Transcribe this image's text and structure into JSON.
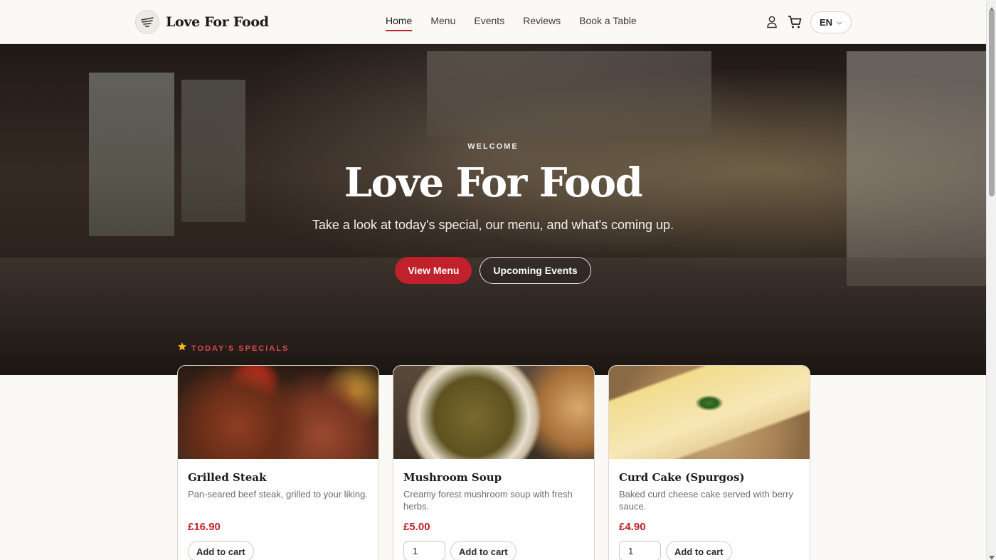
{
  "header": {
    "brand": "Love For Food",
    "nav": [
      {
        "label": "Home",
        "active": true
      },
      {
        "label": "Menu",
        "active": false
      },
      {
        "label": "Events",
        "active": false
      },
      {
        "label": "Reviews",
        "active": false
      },
      {
        "label": "Book a Table",
        "active": false
      }
    ],
    "user_icon": "user-icon",
    "cart_icon": "cart-icon",
    "language": "EN"
  },
  "hero": {
    "eyebrow": "WELCOME",
    "title": "Love For Food",
    "subtitle": "Take a look at today's special, our menu, and what's coming up.",
    "primary_button": "View Menu",
    "secondary_button": "Upcoming Events"
  },
  "specials": {
    "label": "TODAY'S SPECIALS",
    "icon": "star-icon",
    "items": [
      {
        "name": "Grilled Steak",
        "description": "Pan-seared beef steak, grilled to your liking.",
        "price": "£16.90",
        "quantity": "",
        "button": "Add to cart"
      },
      {
        "name": "Mushroom Soup",
        "description": "Creamy forest mushroom soup with fresh herbs.",
        "price": "£5.00",
        "quantity": "1",
        "button": "Add to cart"
      },
      {
        "name": "Curd Cake (Spurgos)",
        "description": "Baked curd cheese cake served with berry sauce.",
        "price": "£4.90",
        "quantity": "1",
        "button": "Add to cart"
      }
    ]
  },
  "colors": {
    "accent": "#c0212a",
    "background": "#fbf9f6"
  }
}
